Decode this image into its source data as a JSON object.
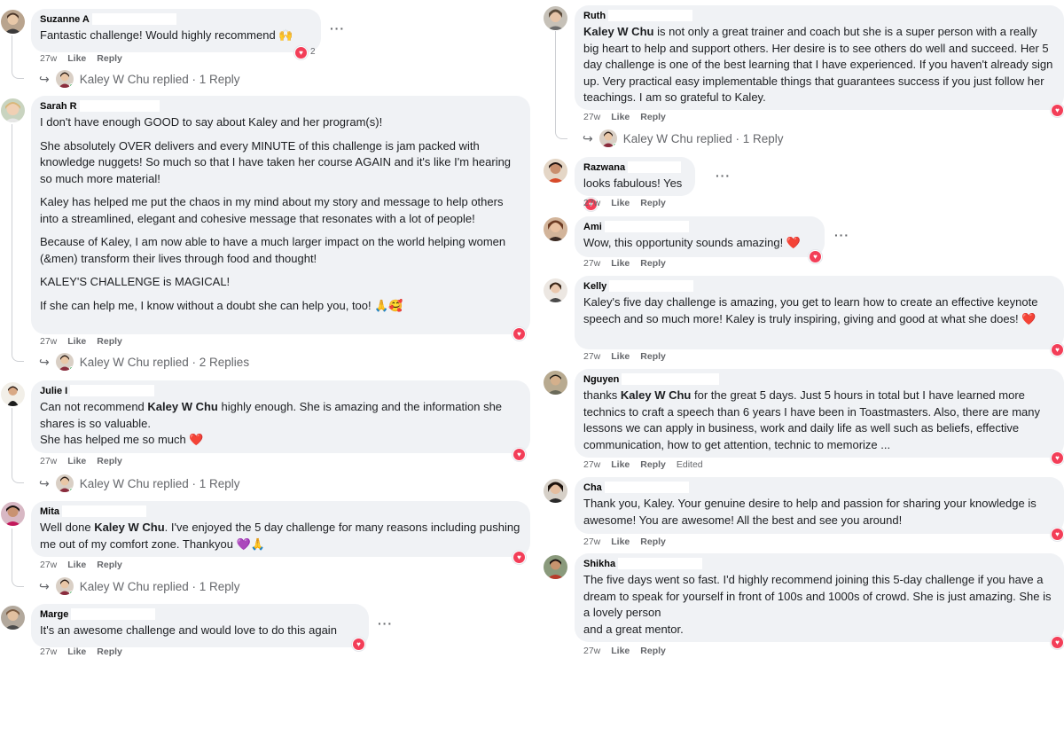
{
  "actions": {
    "time": "27w",
    "like": "Like",
    "reply": "Reply",
    "edited": "Edited"
  },
  "replier_name": "Kaley W Chu",
  "left": [
    {
      "name": "Suzanne A",
      "paragraphs": [
        "Fantastic challenge! Would highly recommend 🙌"
      ],
      "reaction_count": "2",
      "reply_summary": "Kaley W Chu replied · 1 Reply"
    },
    {
      "name": "Sarah R",
      "paragraphs": [
        "I don't have enough GOOD to say about Kaley and her program(s)!",
        "She absolutely OVER delivers and every MINUTE of this challenge is jam packed with knowledge nuggets! So much so that I have taken her course AGAIN and it's like I'm hearing so much more material!",
        "Kaley has helped me put the chaos in my mind about my story and message to help others into a streamlined, elegant and cohesive message that resonates with a lot of people!",
        "Because of Kaley, I am now able to have a much larger impact on the world helping women (&men) transform their lives through food and thought!",
        "KALEY'S CHALLENGE is MAGICAL!",
        "If she can help me, I know without a doubt she can help you, too! 🙏🥰"
      ],
      "reply_summary": "Kaley W Chu replied · 2 Replies"
    },
    {
      "name": "Julie I",
      "paragraphs": [
        "Can not recommend Kaley W Chu highly enough. She is amazing and the information she shares is so valuable.\nShe has helped me so much ❤️"
      ],
      "reply_summary": "Kaley W Chu replied · 1 Reply"
    },
    {
      "name": "Mita",
      "paragraphs": [
        "Well done Kaley W Chu. I've enjoyed the 5 day challenge for many reasons including pushing me out of my comfort zone. Thankyou 💜🙏"
      ],
      "reply_summary": "Kaley W Chu replied · 1 Reply"
    },
    {
      "name": "Marge",
      "paragraphs": [
        "It's an awesome challenge and would love to do this again"
      ]
    }
  ],
  "right": [
    {
      "name": "Ruth",
      "paragraphs": [
        "Kaley W Chu is not only a great trainer and coach but she is a super person with a really big heart to help and support others. Her desire is to see others do well and succeed. Her 5 day challenge is one of the best learning that I have experienced. If you haven't already sign up. Very practical easy implementable things that guarantees success if you just follow her teachings. I am so grateful to Kaley."
      ],
      "reply_summary": "Kaley W Chu replied · 1 Reply"
    },
    {
      "name": "Razwana",
      "paragraphs": [
        "looks fabulous! Yes"
      ]
    },
    {
      "name": "Ami",
      "paragraphs": [
        "Wow, this opportunity sounds amazing! ❤️"
      ]
    },
    {
      "name": "Kelly",
      "paragraphs": [
        "Kaley's five day challenge is amazing, you get to learn how to create an effective keynote speech and so much more! Kaley is truly inspiring, giving and good at what she does! ❤️"
      ]
    },
    {
      "name": "Nguyen",
      "paragraphs": [
        "thanks Kaley W Chu for the great 5 days. Just 5 hours in total but I have learned more technics to craft a speech than 6 years I have been in Toastmasters. Also, there are many lessons we can apply in business, work and daily life as well such as beliefs, effective communication, how to get attention, technic to memorize ..."
      ]
    },
    {
      "name": "Cha",
      "paragraphs": [
        "Thank you, Kaley. Your genuine desire to help and passion for sharing your knowledge is awesome! You are awesome! All the best and see you around!"
      ]
    },
    {
      "name": "Shikha",
      "paragraphs": [
        "The five days went so fast. I'd highly recommend joining this 5-day challenge if you have a dream to speak for yourself in front of 100s and 1000s of crowd. She is just amazing. She is a lovely person\nand a great mentor."
      ]
    }
  ],
  "colors": {
    "bubble": "#f0f2f5",
    "meta": "#65676b",
    "heart": "#f33e58"
  }
}
